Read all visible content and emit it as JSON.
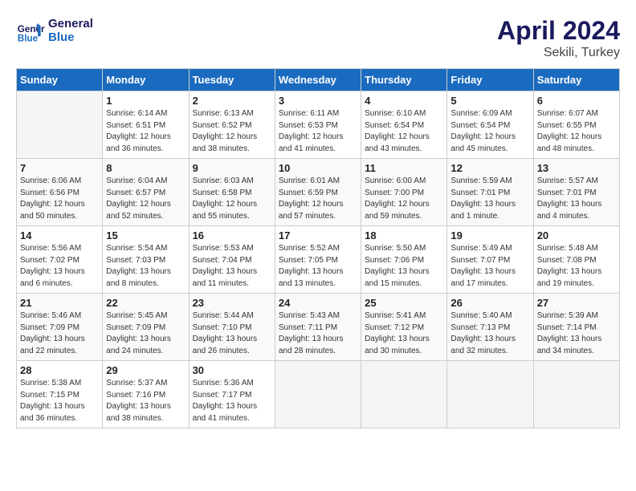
{
  "header": {
    "logo_line1": "General",
    "logo_line2": "Blue",
    "month": "April 2024",
    "location": "Sekili, Turkey"
  },
  "weekdays": [
    "Sunday",
    "Monday",
    "Tuesday",
    "Wednesday",
    "Thursday",
    "Friday",
    "Saturday"
  ],
  "weeks": [
    [
      {
        "day": "",
        "info": ""
      },
      {
        "day": "1",
        "info": "Sunrise: 6:14 AM\nSunset: 6:51 PM\nDaylight: 12 hours\nand 36 minutes."
      },
      {
        "day": "2",
        "info": "Sunrise: 6:13 AM\nSunset: 6:52 PM\nDaylight: 12 hours\nand 38 minutes."
      },
      {
        "day": "3",
        "info": "Sunrise: 6:11 AM\nSunset: 6:53 PM\nDaylight: 12 hours\nand 41 minutes."
      },
      {
        "day": "4",
        "info": "Sunrise: 6:10 AM\nSunset: 6:54 PM\nDaylight: 12 hours\nand 43 minutes."
      },
      {
        "day": "5",
        "info": "Sunrise: 6:09 AM\nSunset: 6:54 PM\nDaylight: 12 hours\nand 45 minutes."
      },
      {
        "day": "6",
        "info": "Sunrise: 6:07 AM\nSunset: 6:55 PM\nDaylight: 12 hours\nand 48 minutes."
      }
    ],
    [
      {
        "day": "7",
        "info": "Sunrise: 6:06 AM\nSunset: 6:56 PM\nDaylight: 12 hours\nand 50 minutes."
      },
      {
        "day": "8",
        "info": "Sunrise: 6:04 AM\nSunset: 6:57 PM\nDaylight: 12 hours\nand 52 minutes."
      },
      {
        "day": "9",
        "info": "Sunrise: 6:03 AM\nSunset: 6:58 PM\nDaylight: 12 hours\nand 55 minutes."
      },
      {
        "day": "10",
        "info": "Sunrise: 6:01 AM\nSunset: 6:59 PM\nDaylight: 12 hours\nand 57 minutes."
      },
      {
        "day": "11",
        "info": "Sunrise: 6:00 AM\nSunset: 7:00 PM\nDaylight: 12 hours\nand 59 minutes."
      },
      {
        "day": "12",
        "info": "Sunrise: 5:59 AM\nSunset: 7:01 PM\nDaylight: 13 hours\nand 1 minute."
      },
      {
        "day": "13",
        "info": "Sunrise: 5:57 AM\nSunset: 7:01 PM\nDaylight: 13 hours\nand 4 minutes."
      }
    ],
    [
      {
        "day": "14",
        "info": "Sunrise: 5:56 AM\nSunset: 7:02 PM\nDaylight: 13 hours\nand 6 minutes."
      },
      {
        "day": "15",
        "info": "Sunrise: 5:54 AM\nSunset: 7:03 PM\nDaylight: 13 hours\nand 8 minutes."
      },
      {
        "day": "16",
        "info": "Sunrise: 5:53 AM\nSunset: 7:04 PM\nDaylight: 13 hours\nand 11 minutes."
      },
      {
        "day": "17",
        "info": "Sunrise: 5:52 AM\nSunset: 7:05 PM\nDaylight: 13 hours\nand 13 minutes."
      },
      {
        "day": "18",
        "info": "Sunrise: 5:50 AM\nSunset: 7:06 PM\nDaylight: 13 hours\nand 15 minutes."
      },
      {
        "day": "19",
        "info": "Sunrise: 5:49 AM\nSunset: 7:07 PM\nDaylight: 13 hours\nand 17 minutes."
      },
      {
        "day": "20",
        "info": "Sunrise: 5:48 AM\nSunset: 7:08 PM\nDaylight: 13 hours\nand 19 minutes."
      }
    ],
    [
      {
        "day": "21",
        "info": "Sunrise: 5:46 AM\nSunset: 7:09 PM\nDaylight: 13 hours\nand 22 minutes."
      },
      {
        "day": "22",
        "info": "Sunrise: 5:45 AM\nSunset: 7:09 PM\nDaylight: 13 hours\nand 24 minutes."
      },
      {
        "day": "23",
        "info": "Sunrise: 5:44 AM\nSunset: 7:10 PM\nDaylight: 13 hours\nand 26 minutes."
      },
      {
        "day": "24",
        "info": "Sunrise: 5:43 AM\nSunset: 7:11 PM\nDaylight: 13 hours\nand 28 minutes."
      },
      {
        "day": "25",
        "info": "Sunrise: 5:41 AM\nSunset: 7:12 PM\nDaylight: 13 hours\nand 30 minutes."
      },
      {
        "day": "26",
        "info": "Sunrise: 5:40 AM\nSunset: 7:13 PM\nDaylight: 13 hours\nand 32 minutes."
      },
      {
        "day": "27",
        "info": "Sunrise: 5:39 AM\nSunset: 7:14 PM\nDaylight: 13 hours\nand 34 minutes."
      }
    ],
    [
      {
        "day": "28",
        "info": "Sunrise: 5:38 AM\nSunset: 7:15 PM\nDaylight: 13 hours\nand 36 minutes."
      },
      {
        "day": "29",
        "info": "Sunrise: 5:37 AM\nSunset: 7:16 PM\nDaylight: 13 hours\nand 38 minutes."
      },
      {
        "day": "30",
        "info": "Sunrise: 5:36 AM\nSunset: 7:17 PM\nDaylight: 13 hours\nand 41 minutes."
      },
      {
        "day": "",
        "info": ""
      },
      {
        "day": "",
        "info": ""
      },
      {
        "day": "",
        "info": ""
      },
      {
        "day": "",
        "info": ""
      }
    ]
  ]
}
